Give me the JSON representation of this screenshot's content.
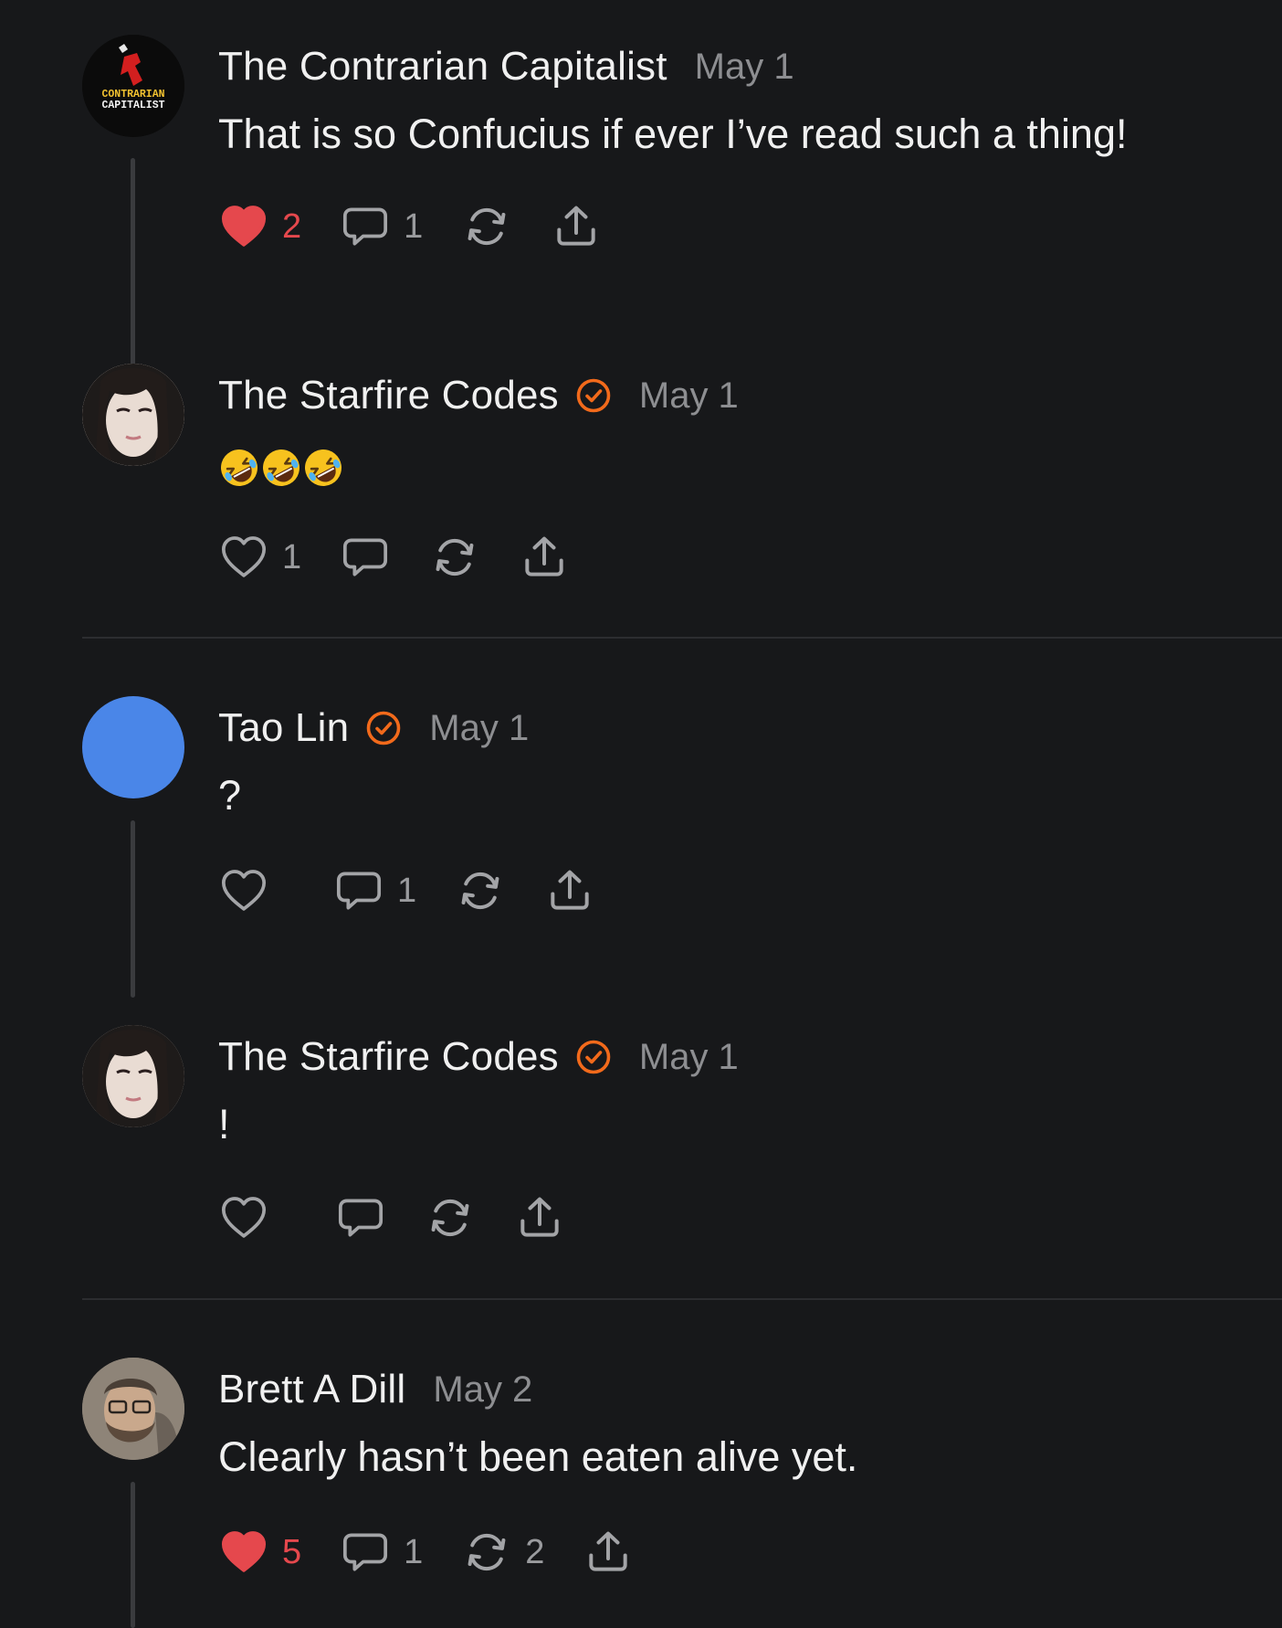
{
  "colors": {
    "background": "#17181a",
    "accent": "#f26a1b",
    "like": "#e5484d",
    "muted": "#8d8e91"
  },
  "posts": [
    {
      "author": "The Contrarian Capitalist",
      "avatar_text": [
        "CONTRARIAN",
        "CAPITALIST"
      ],
      "verified": false,
      "date": "May 1",
      "body": "That is so Confucius if ever I’ve read such a thing!",
      "likes": "2",
      "liked": true,
      "replies": "1",
      "restacks": ""
    },
    {
      "author": "The Starfire Codes",
      "verified": true,
      "date": "May 1",
      "body_emoji": [
        "rolling-on-floor-laughing",
        "rolling-on-floor-laughing",
        "rolling-on-floor-laughing"
      ],
      "likes": "1",
      "liked": false,
      "replies": "",
      "restacks": ""
    },
    {
      "author": "Tao Lin",
      "verified": true,
      "date": "May 1",
      "body": "?",
      "likes": "",
      "liked": false,
      "replies": "1",
      "restacks": ""
    },
    {
      "author": "The Starfire Codes",
      "verified": true,
      "date": "May 1",
      "body": "!",
      "likes": "",
      "liked": false,
      "replies": "",
      "restacks": ""
    },
    {
      "author": "Brett A Dill",
      "verified": false,
      "date": "May 2",
      "body": "Clearly hasn’t been eaten alive yet.",
      "likes": "5",
      "liked": true,
      "replies": "1",
      "restacks": "2"
    }
  ],
  "icons": [
    "heart-icon",
    "comment-icon",
    "restack-icon",
    "share-icon",
    "verified-check-icon"
  ]
}
